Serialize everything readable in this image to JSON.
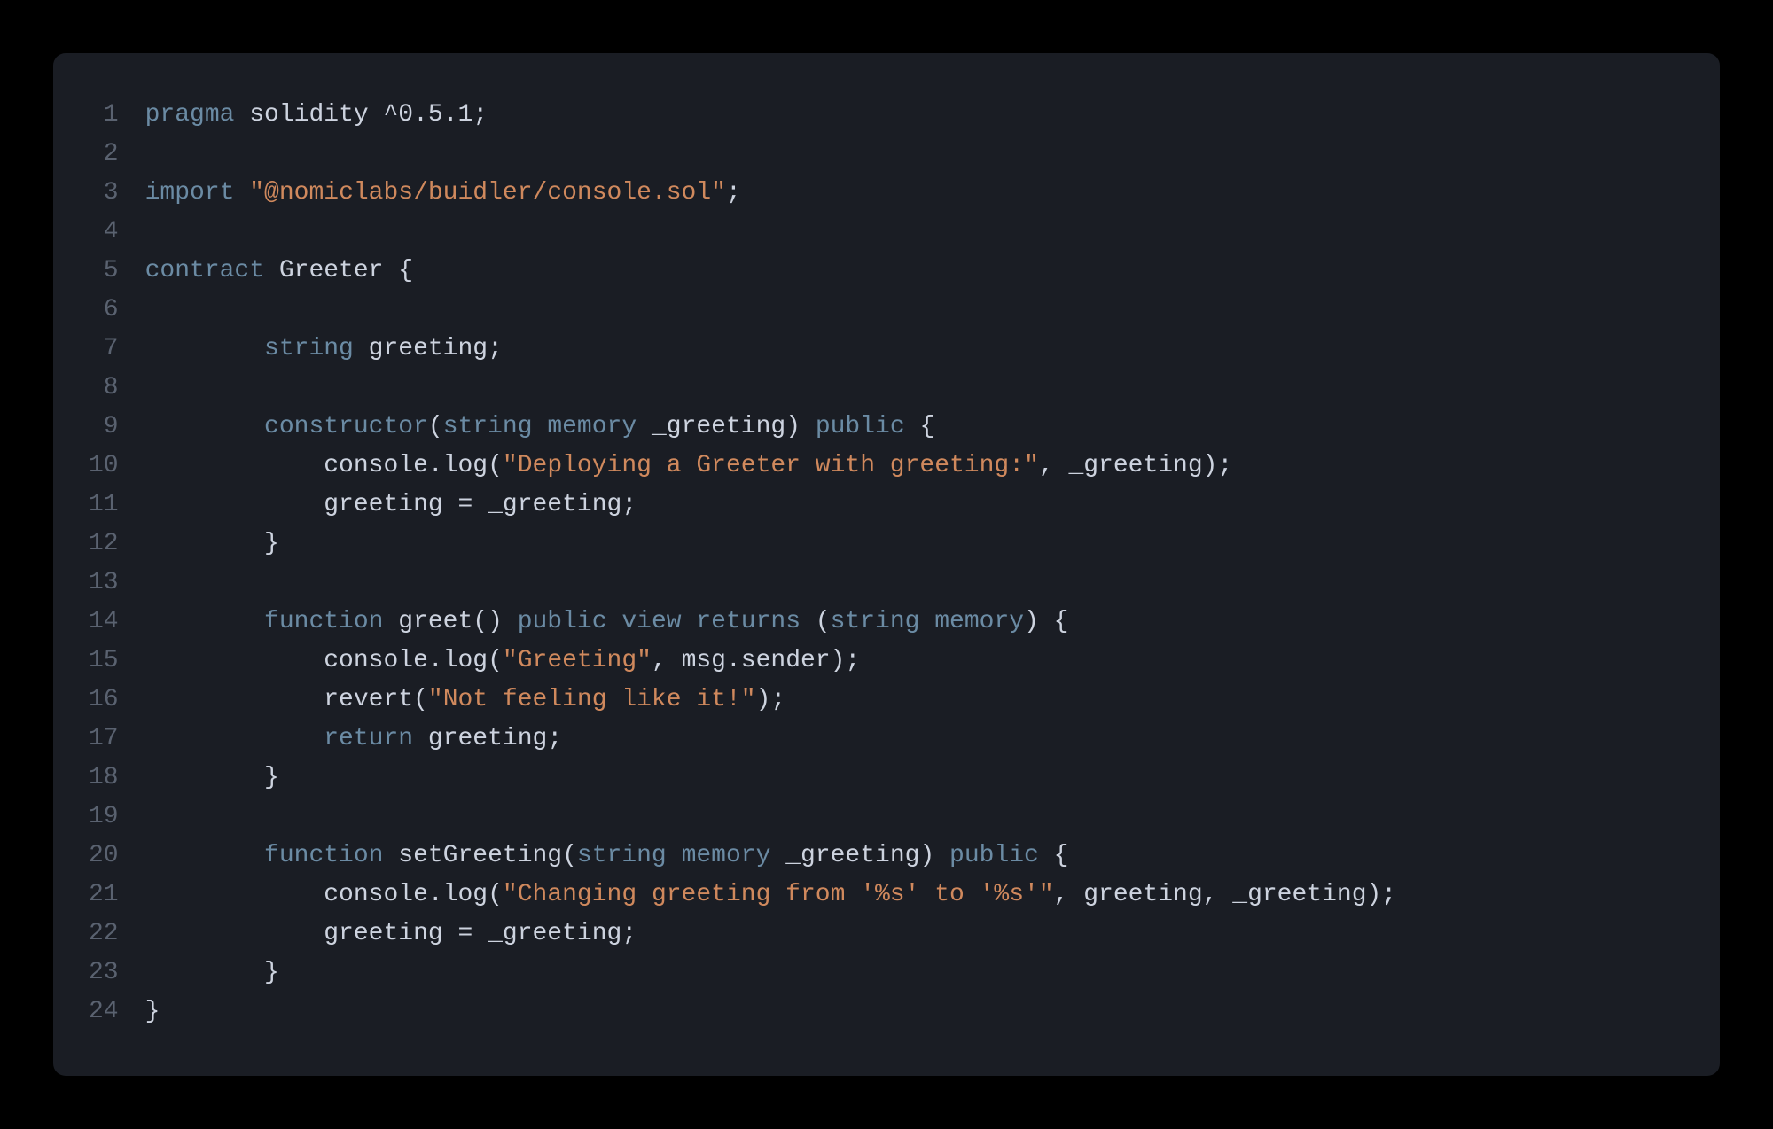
{
  "colors": {
    "background_outer": "#000000",
    "background_editor": "#1a1d24",
    "line_number": "#5a6270",
    "default": "#cdd3df",
    "keyword": "#6b8ba4",
    "string": "#d0895d"
  },
  "code": {
    "lines": [
      {
        "n": "1",
        "tokens": [
          [
            "kw",
            "pragma"
          ],
          [
            "punc",
            " "
          ],
          [
            "id",
            "solidity"
          ],
          [
            "punc",
            " "
          ],
          [
            "ver",
            "^0.5.1"
          ],
          [
            "punc",
            ";"
          ]
        ]
      },
      {
        "n": "2",
        "tokens": []
      },
      {
        "n": "3",
        "tokens": [
          [
            "kw",
            "import"
          ],
          [
            "punc",
            " "
          ],
          [
            "str",
            "\"@nomiclabs/buidler/console.sol\""
          ],
          [
            "punc",
            ";"
          ]
        ]
      },
      {
        "n": "4",
        "tokens": []
      },
      {
        "n": "5",
        "tokens": [
          [
            "kw",
            "contract"
          ],
          [
            "punc",
            " "
          ],
          [
            "id",
            "Greeter"
          ],
          [
            "punc",
            " {"
          ]
        ]
      },
      {
        "n": "6",
        "tokens": []
      },
      {
        "n": "7",
        "tokens": [
          [
            "punc",
            "        "
          ],
          [
            "type",
            "string"
          ],
          [
            "punc",
            " "
          ],
          [
            "id",
            "greeting"
          ],
          [
            "punc",
            ";"
          ]
        ]
      },
      {
        "n": "8",
        "tokens": []
      },
      {
        "n": "9",
        "tokens": [
          [
            "punc",
            "        "
          ],
          [
            "kw",
            "constructor"
          ],
          [
            "punc",
            "("
          ],
          [
            "type",
            "string"
          ],
          [
            "punc",
            " "
          ],
          [
            "type",
            "memory"
          ],
          [
            "punc",
            " "
          ],
          [
            "id",
            "_greeting"
          ],
          [
            "punc",
            ") "
          ],
          [
            "kw",
            "public"
          ],
          [
            "punc",
            " {"
          ]
        ]
      },
      {
        "n": "10",
        "tokens": [
          [
            "punc",
            "            "
          ],
          [
            "id",
            "console"
          ],
          [
            "punc",
            "."
          ],
          [
            "id",
            "log"
          ],
          [
            "punc",
            "("
          ],
          [
            "str",
            "\"Deploying a Greeter with greeting:\""
          ],
          [
            "punc",
            ", "
          ],
          [
            "id",
            "_greeting"
          ],
          [
            "punc",
            ");"
          ]
        ]
      },
      {
        "n": "11",
        "tokens": [
          [
            "punc",
            "            "
          ],
          [
            "id",
            "greeting"
          ],
          [
            "punc",
            " = "
          ],
          [
            "id",
            "_greeting"
          ],
          [
            "punc",
            ";"
          ]
        ]
      },
      {
        "n": "12",
        "tokens": [
          [
            "punc",
            "        }"
          ]
        ]
      },
      {
        "n": "13",
        "tokens": []
      },
      {
        "n": "14",
        "tokens": [
          [
            "punc",
            "        "
          ],
          [
            "kw",
            "function"
          ],
          [
            "punc",
            " "
          ],
          [
            "id",
            "greet"
          ],
          [
            "punc",
            "() "
          ],
          [
            "kw",
            "public"
          ],
          [
            "punc",
            " "
          ],
          [
            "kw",
            "view"
          ],
          [
            "punc",
            " "
          ],
          [
            "kw",
            "returns"
          ],
          [
            "punc",
            " ("
          ],
          [
            "type",
            "string"
          ],
          [
            "punc",
            " "
          ],
          [
            "type",
            "memory"
          ],
          [
            "punc",
            ") {"
          ]
        ]
      },
      {
        "n": "15",
        "tokens": [
          [
            "punc",
            "            "
          ],
          [
            "id",
            "console"
          ],
          [
            "punc",
            "."
          ],
          [
            "id",
            "log"
          ],
          [
            "punc",
            "("
          ],
          [
            "str",
            "\"Greeting\""
          ],
          [
            "punc",
            ", "
          ],
          [
            "id",
            "msg"
          ],
          [
            "punc",
            "."
          ],
          [
            "id",
            "sender"
          ],
          [
            "punc",
            ");"
          ]
        ]
      },
      {
        "n": "16",
        "tokens": [
          [
            "punc",
            "            "
          ],
          [
            "id",
            "revert"
          ],
          [
            "punc",
            "("
          ],
          [
            "str",
            "\"Not feeling like it!\""
          ],
          [
            "punc",
            ");"
          ]
        ]
      },
      {
        "n": "17",
        "tokens": [
          [
            "punc",
            "            "
          ],
          [
            "kw",
            "return"
          ],
          [
            "punc",
            " "
          ],
          [
            "id",
            "greeting"
          ],
          [
            "punc",
            ";"
          ]
        ]
      },
      {
        "n": "18",
        "tokens": [
          [
            "punc",
            "        }"
          ]
        ]
      },
      {
        "n": "19",
        "tokens": []
      },
      {
        "n": "20",
        "tokens": [
          [
            "punc",
            "        "
          ],
          [
            "kw",
            "function"
          ],
          [
            "punc",
            " "
          ],
          [
            "id",
            "setGreeting"
          ],
          [
            "punc",
            "("
          ],
          [
            "type",
            "string"
          ],
          [
            "punc",
            " "
          ],
          [
            "type",
            "memory"
          ],
          [
            "punc",
            " "
          ],
          [
            "id",
            "_greeting"
          ],
          [
            "punc",
            ") "
          ],
          [
            "kw",
            "public"
          ],
          [
            "punc",
            " {"
          ]
        ]
      },
      {
        "n": "21",
        "tokens": [
          [
            "punc",
            "            "
          ],
          [
            "id",
            "console"
          ],
          [
            "punc",
            "."
          ],
          [
            "id",
            "log"
          ],
          [
            "punc",
            "("
          ],
          [
            "str",
            "\"Changing greeting from '%s' to '%s'\""
          ],
          [
            "punc",
            ", "
          ],
          [
            "id",
            "greeting"
          ],
          [
            "punc",
            ", "
          ],
          [
            "id",
            "_greeting"
          ],
          [
            "punc",
            ");"
          ]
        ]
      },
      {
        "n": "22",
        "tokens": [
          [
            "punc",
            "            "
          ],
          [
            "id",
            "greeting"
          ],
          [
            "punc",
            " = "
          ],
          [
            "id",
            "_greeting"
          ],
          [
            "punc",
            ";"
          ]
        ]
      },
      {
        "n": "23",
        "tokens": [
          [
            "punc",
            "        }"
          ]
        ]
      },
      {
        "n": "24",
        "tokens": [
          [
            "punc",
            "}"
          ]
        ]
      }
    ]
  }
}
